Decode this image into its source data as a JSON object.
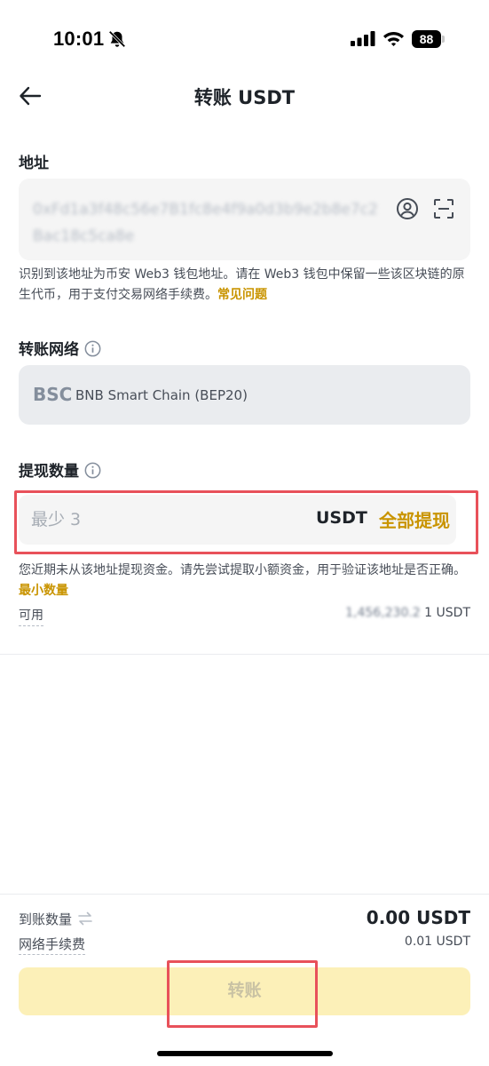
{
  "status_bar": {
    "time": "10:01",
    "battery": "88"
  },
  "header": {
    "title": "转账 USDT"
  },
  "address": {
    "label": "地址",
    "value": "0xFd1a3f48c56e7B1fc8e4f9a0d3b9e2b8e7c2Bac18c5ca8e",
    "helper_text": "识别到该地址为币安 Web3 钱包地址。请在 Web3 钱包中保留一些该区块链的原生代币，用于支付交易网络手续费。",
    "helper_link": "常见问题"
  },
  "network": {
    "label": "转账网络",
    "code": "BSC",
    "name": "BNB Smart Chain (BEP20)"
  },
  "amount": {
    "label": "提现数量",
    "placeholder": "最少 3",
    "unit": "USDT",
    "max_label": "全部提现",
    "helper_text": "您近期未从该地址提现资金。请先尝试提取小额资金，用于验证该地址是否正确。",
    "helper_link": "最小数量",
    "available_label": "可用",
    "available_value_obscured": "1,456,230.2",
    "available_value_visible": "1 USDT"
  },
  "summary": {
    "receive_label": "到账数量",
    "receive_value": "0.00 USDT",
    "fee_label": "网络手续费",
    "fee_value": "0.01 USDT"
  },
  "submit": {
    "label": "转账"
  },
  "colors": {
    "accent": "#c99400",
    "button_disabled_bg": "#fcf0b8",
    "highlight_outline": "#e8515a"
  }
}
